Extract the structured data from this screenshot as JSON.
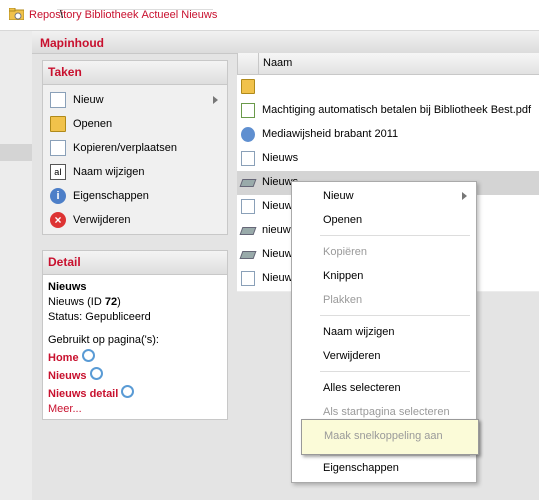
{
  "breadcrumb": {
    "items": [
      "Repository",
      "Bibliotheek",
      "Actueel",
      "Nieuws"
    ],
    "separator": "\\"
  },
  "panel": {
    "title": "Mapinhoud"
  },
  "taken": {
    "title": "Taken",
    "items": [
      {
        "label": "Nieuw",
        "icon": "new-document-icon",
        "has_submenu": true
      },
      {
        "label": "Openen",
        "icon": "open-folder-icon"
      },
      {
        "label": "Kopieren/verplaatsen",
        "icon": "copy-icon"
      },
      {
        "label": "Naam wijzigen",
        "icon": "rename-icon"
      },
      {
        "label": "Eigenschappen",
        "icon": "info-icon"
      },
      {
        "label": "Verwijderen",
        "icon": "delete-icon"
      }
    ]
  },
  "detail": {
    "title": "Detail",
    "name": "Nieuws",
    "id_line_prefix": "Nieuws (ID ",
    "id": "72",
    "id_line_suffix": ")",
    "status": "Status: Gepubliceerd",
    "used_on": "Gebruikt op pagina('s):",
    "pages": [
      "Home",
      "Nieuws",
      "Nieuws detail"
    ],
    "more": "Meer..."
  },
  "list": {
    "column_name": "Naam",
    "rows": [
      {
        "label": "",
        "icon": "folder-up-icon"
      },
      {
        "label": "Machtiging automatisch betalen bij Bibliotheek Best.pdf",
        "icon": "pdf-icon"
      },
      {
        "label": "Mediawijsheid brabant 2011",
        "icon": "media-icon"
      },
      {
        "label": "Nieuws",
        "icon": "document-icon"
      },
      {
        "label": "Nieuws",
        "icon": "shelf-icon",
        "selected": true
      },
      {
        "label": "Nieuw",
        "icon": "document-icon"
      },
      {
        "label": "nieuw",
        "icon": "shelf-icon"
      },
      {
        "label": "Nieuw",
        "icon": "shelf-icon"
      },
      {
        "label": "Nieuw",
        "icon": "document-icon"
      }
    ]
  },
  "context_menu": {
    "items": [
      {
        "label": "Nieuw",
        "enabled": true,
        "submenu": true
      },
      {
        "label": "Openen",
        "enabled": true
      },
      {
        "label": "Kopiëren",
        "enabled": false
      },
      {
        "label": "Knippen",
        "enabled": true
      },
      {
        "label": "Plakken",
        "enabled": false
      },
      {
        "label": "Naam wijzigen",
        "enabled": true
      },
      {
        "label": "Verwijderen",
        "enabled": true
      },
      {
        "label": "Alles selecteren",
        "enabled": true
      },
      {
        "label": "Als startpagina selecteren",
        "enabled": false
      },
      {
        "label": "Maak snelkoppeling aan",
        "enabled": false,
        "highlighted": true
      },
      {
        "label": "Eigenschappen",
        "enabled": true
      }
    ]
  },
  "colors": {
    "accent": "#c8102e",
    "highlight": "#fbfbd8"
  }
}
